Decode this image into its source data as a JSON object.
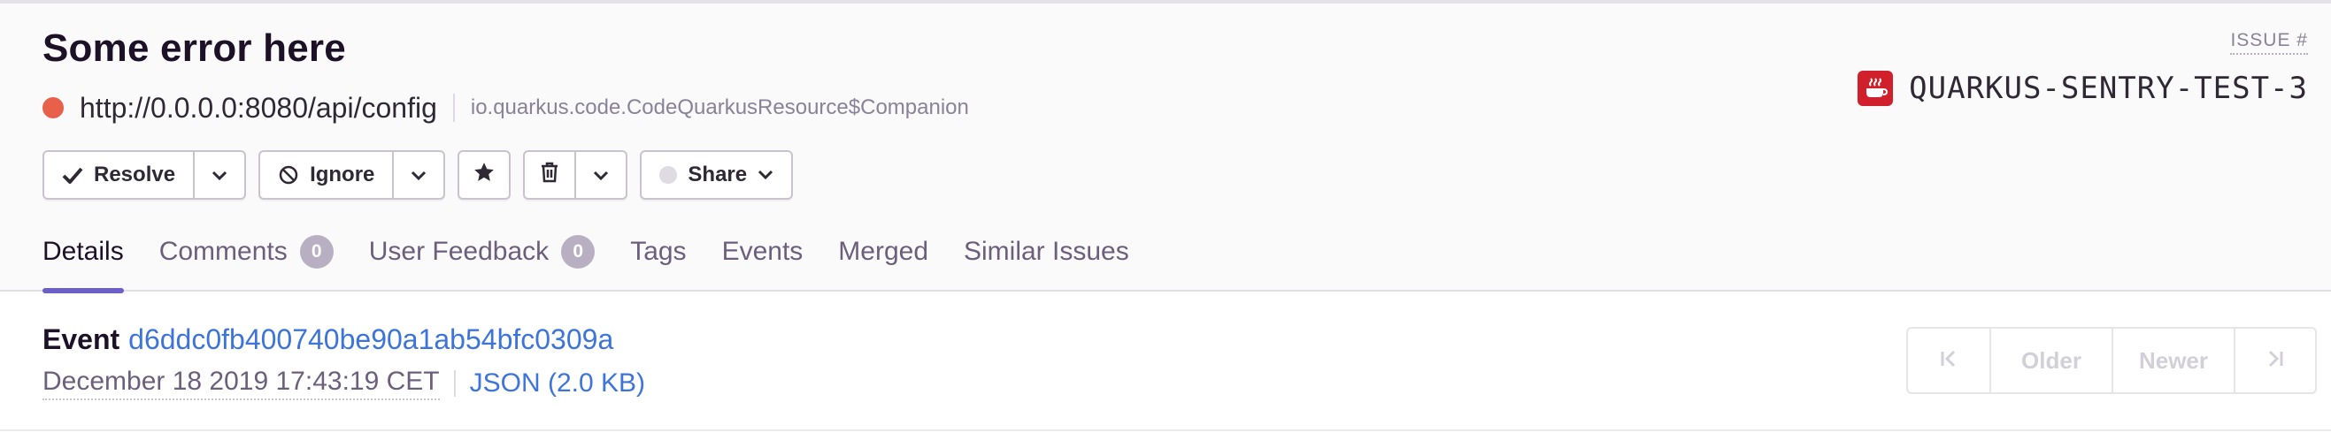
{
  "header": {
    "title": "Some error here",
    "url": "http://0.0.0.0:8080/api/config",
    "culprit": "io.quarkus.code.CodeQuarkusResource$Companion",
    "issue_label": "ISSUE #",
    "issue_id": "QUARKUS-SENTRY-TEST-3"
  },
  "actions": {
    "resolve": "Resolve",
    "ignore": "Ignore",
    "share": "Share"
  },
  "tabs": [
    {
      "label": "Details"
    },
    {
      "label": "Comments",
      "count": "0"
    },
    {
      "label": "User Feedback",
      "count": "0"
    },
    {
      "label": "Tags"
    },
    {
      "label": "Events"
    },
    {
      "label": "Merged"
    },
    {
      "label": "Similar Issues"
    }
  ],
  "event": {
    "label": "Event",
    "id": "d6ddc0fb400740be90a1ab54bfc0309a",
    "date": "December 18 2019 17:43:19 CET",
    "json": "JSON (2.0 KB)"
  },
  "pager": {
    "older": "Older",
    "newer": "Newer"
  },
  "colors": {
    "status_dot": "#e8604a",
    "accent": "#6c5fc7",
    "link": "#3d74db",
    "project_icon": "#d0202b"
  },
  "icons": {
    "resolve": "checkmark-icon",
    "ignore": "ban-icon",
    "bookmark": "star-icon",
    "delete": "trash-icon",
    "project": "java-coffee-icon",
    "oldest": "first-page-icon",
    "newest": "last-page-icon"
  }
}
